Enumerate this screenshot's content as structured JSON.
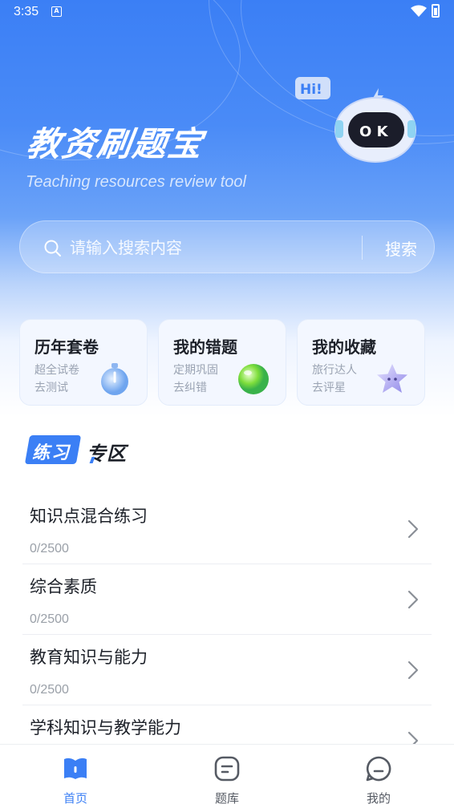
{
  "status_bar": {
    "time": "3:35",
    "notification_letter": "A"
  },
  "header": {
    "title": "教资刷题宝",
    "subtitle": "Teaching resources review tool",
    "mascot_bubble": "Hi!",
    "mascot_face": "O K"
  },
  "search": {
    "placeholder": "请输入搜索内容",
    "value": "",
    "button_label": "搜索"
  },
  "quick_cards": [
    {
      "title": "历年套卷",
      "line1": "超全试卷",
      "line2": "去测试",
      "icon": "stopwatch-icon"
    },
    {
      "title": "我的错题",
      "line1": "定期巩固",
      "line2": "去纠错",
      "icon": "green-ball-icon"
    },
    {
      "title": "我的收藏",
      "line1": "旅行达人",
      "line2": "去评星",
      "icon": "star-icon"
    }
  ],
  "practice_section": {
    "tag": "练习",
    "title": "专区",
    "items": [
      {
        "title": "知识点混合练习",
        "progress": "0/2500"
      },
      {
        "title": "综合素质",
        "progress": "0/2500"
      },
      {
        "title": "教育知识与能力",
        "progress": "0/2500"
      },
      {
        "title": "学科知识与教学能力",
        "progress": ""
      }
    ]
  },
  "bottom_nav": [
    {
      "label": "首页",
      "icon": "book-icon",
      "active": true
    },
    {
      "label": "题库",
      "icon": "question-bank-icon",
      "active": false
    },
    {
      "label": "我的",
      "icon": "profile-chat-icon",
      "active": false
    }
  ],
  "colors": {
    "primary": "#3b7ff5",
    "text": "#1d2129",
    "muted": "#9aa0a8"
  }
}
